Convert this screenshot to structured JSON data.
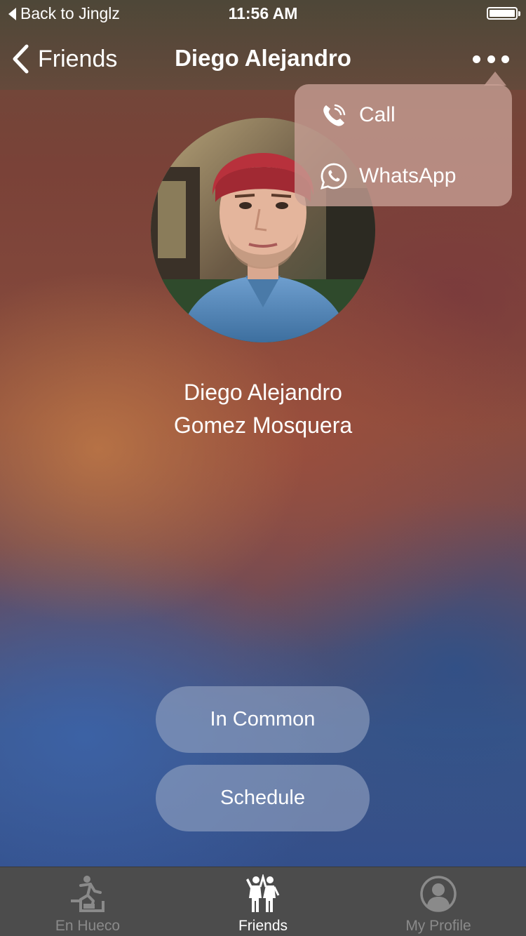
{
  "status_bar": {
    "back_app_label": "Back to Jinglz",
    "time": "11:56 AM"
  },
  "nav": {
    "back_label": "Friends",
    "title": "Diego Alejandro",
    "more_icon": "more-horizontal-icon"
  },
  "popover": {
    "items": [
      {
        "label": "Call",
        "icon": "phone-icon"
      },
      {
        "label": "WhatsApp",
        "icon": "whatsapp-icon"
      }
    ]
  },
  "profile": {
    "first_name": "Diego Alejandro",
    "last_name": "Gomez Mosquera"
  },
  "buttons": {
    "in_common": "In Common",
    "schedule": "Schedule"
  },
  "tab_bar": {
    "tabs": [
      {
        "label": "En Hueco",
        "icon": "running-person-icon",
        "active": false
      },
      {
        "label": "Friends",
        "icon": "friends-icon",
        "active": true
      },
      {
        "label": "My Profile",
        "icon": "profile-icon",
        "active": false
      }
    ]
  },
  "colors": {
    "tab_bar_bg": "#4c4c4c",
    "tab_active": "#ffffff",
    "tab_inactive": "#8a8a8a"
  }
}
